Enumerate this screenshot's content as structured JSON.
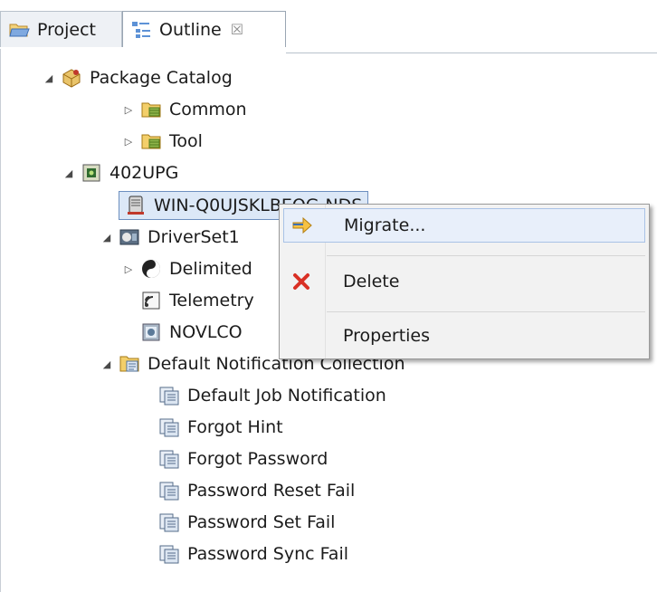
{
  "tabs": {
    "project": "Project",
    "outline": "Outline",
    "close": "☒"
  },
  "tree": {
    "package_catalog": "Package Catalog",
    "common": "Common",
    "tool": "Tool",
    "upg": "402UPG",
    "server": "WIN-Q0UJSKLBEQG-NDS",
    "driverset": "DriverSet1",
    "delimited": "Delimited",
    "telemetry": "Telemetry",
    "novlco": "NOVLCO",
    "notif_collection": "Default Notification Collection",
    "notifications": [
      "Default Job Notification",
      "Forgot Hint",
      "Forgot Password",
      "Password Reset Fail",
      "Password Set Fail",
      "Password Sync Fail"
    ]
  },
  "context_menu": {
    "migrate": "Migrate...",
    "delete": "Delete",
    "properties": "Properties"
  },
  "colors": {
    "selection": "#dce8f7",
    "menu_bg": "#f2f2f2",
    "delete_icon": "#d93025",
    "migrate_icon": "#f0b429"
  }
}
